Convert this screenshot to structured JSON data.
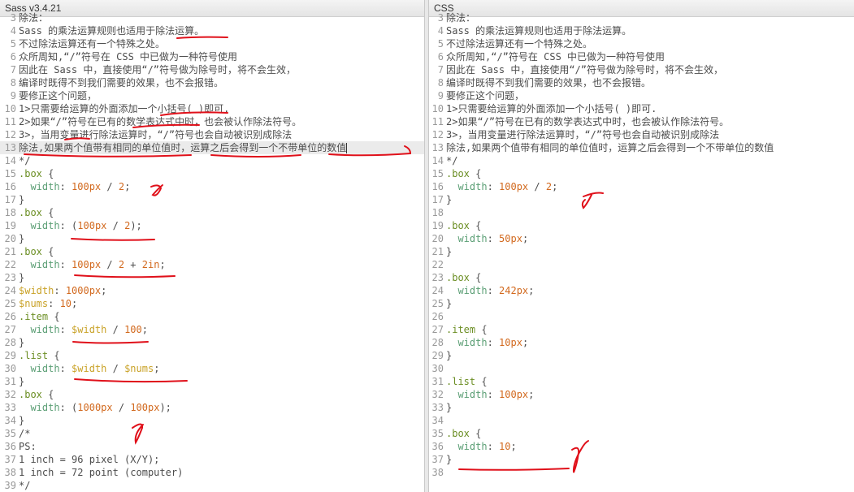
{
  "left_pane": {
    "title": "Sass v3.4.21",
    "lines": [
      {
        "n": "3",
        "t": "除法："
      },
      {
        "n": "4",
        "t": "Sass 的乘法运算规则也适用于除法运算。"
      },
      {
        "n": "5",
        "t": "不过除法运算还有一个特殊之处。"
      },
      {
        "n": "6",
        "t": "众所周知,“/”符号在 CSS 中已做为一种符号使用"
      },
      {
        "n": "7",
        "t": "因此在 Sass 中，直接使用“/”符号做为除号时，将不会生效，"
      },
      {
        "n": "8",
        "t": "编译时既得不到我们需要的效果，也不会报错。"
      },
      {
        "n": "9",
        "t": "要修正这个问题，"
      },
      {
        "n": "10",
        "t": "1>只需要给运算的外面添加一个小括号( )即可."
      },
      {
        "n": "11",
        "t": "2>如果“/”符号在已有的数学表达式中时，也会被认作除法符号。"
      },
      {
        "n": "12",
        "t": "3>，当用变量进行除法运算时，“/”符号也会自动被识别成除法"
      },
      {
        "n": "13",
        "t": "除法,如果两个值带有相同的单位值时，运算之后会得到一个不带单位的数值"
      },
      {
        "n": "14",
        "t": "*/"
      },
      {
        "n": "15",
        "t": ".box {"
      },
      {
        "n": "16",
        "t": "  width: 100px / 2;"
      },
      {
        "n": "17",
        "t": "}"
      },
      {
        "n": "18",
        "t": ".box {"
      },
      {
        "n": "19",
        "t": "  width: (100px / 2);"
      },
      {
        "n": "20",
        "t": "}"
      },
      {
        "n": "21",
        "t": ".box {"
      },
      {
        "n": "22",
        "t": "  width: 100px / 2 + 2in;"
      },
      {
        "n": "23",
        "t": "}"
      },
      {
        "n": "24",
        "t": "$width: 1000px;"
      },
      {
        "n": "25",
        "t": "$nums: 10;"
      },
      {
        "n": "26",
        "t": ".item {"
      },
      {
        "n": "27",
        "t": "  width: $width / 100;"
      },
      {
        "n": "28",
        "t": "}"
      },
      {
        "n": "29",
        "t": ".list {"
      },
      {
        "n": "30",
        "t": "  width: $width / $nums;"
      },
      {
        "n": "31",
        "t": "}"
      },
      {
        "n": "32",
        "t": ".box {"
      },
      {
        "n": "33",
        "t": "  width: (1000px / 100px);"
      },
      {
        "n": "34",
        "t": "}"
      },
      {
        "n": "35",
        "t": "/*"
      },
      {
        "n": "36",
        "t": "PS:"
      },
      {
        "n": "37",
        "t": "1 inch = 96 pixel (X/Y);"
      },
      {
        "n": "38",
        "t": "1 inch = 72 point (computer)"
      },
      {
        "n": "39",
        "t": "*/"
      }
    ]
  },
  "right_pane": {
    "title": "CSS",
    "lines": [
      {
        "n": "3",
        "t": "除法："
      },
      {
        "n": "4",
        "t": "Sass 的乘法运算规则也适用于除法运算。"
      },
      {
        "n": "5",
        "t": "不过除法运算还有一个特殊之处。"
      },
      {
        "n": "6",
        "t": "众所周知,“/”符号在 CSS 中已做为一种符号使用"
      },
      {
        "n": "7",
        "t": "因此在 Sass 中，直接使用“/”符号做为除号时，将不会生效，"
      },
      {
        "n": "8",
        "t": "编译时既得不到我们需要的效果，也不会报错。"
      },
      {
        "n": "9",
        "t": "要修正这个问题，"
      },
      {
        "n": "10",
        "t": "1>只需要给运算的外面添加一个小括号( )即可."
      },
      {
        "n": "11",
        "t": "2>如果“/”符号在已有的数学表达式中时，也会被认作除法符号。"
      },
      {
        "n": "12",
        "t": "3>，当用变量进行除法运算时，“/”符号也会自动被识别成除法"
      },
      {
        "n": "13",
        "t": "除法,如果两个值带有相同的单位值时，运算之后会得到一个不带单位的数值"
      },
      {
        "n": "14",
        "t": "*/"
      },
      {
        "n": "15",
        "t": ".box {"
      },
      {
        "n": "16",
        "t": "  width: 100px / 2;"
      },
      {
        "n": "17",
        "t": "}"
      },
      {
        "n": "18",
        "t": ""
      },
      {
        "n": "19",
        "t": ".box {"
      },
      {
        "n": "20",
        "t": "  width: 50px;"
      },
      {
        "n": "21",
        "t": "}"
      },
      {
        "n": "22",
        "t": ""
      },
      {
        "n": "23",
        "t": ".box {"
      },
      {
        "n": "24",
        "t": "  width: 242px;"
      },
      {
        "n": "25",
        "t": "}"
      },
      {
        "n": "26",
        "t": ""
      },
      {
        "n": "27",
        "t": ".item {"
      },
      {
        "n": "28",
        "t": "  width: 10px;"
      },
      {
        "n": "29",
        "t": "}"
      },
      {
        "n": "30",
        "t": ""
      },
      {
        "n": "31",
        "t": ".list {"
      },
      {
        "n": "32",
        "t": "  width: 100px;"
      },
      {
        "n": "33",
        "t": "}"
      },
      {
        "n": "34",
        "t": ""
      },
      {
        "n": "35",
        "t": ".box {"
      },
      {
        "n": "36",
        "t": "  width: 10;"
      },
      {
        "n": "37",
        "t": "}"
      },
      {
        "n": "38",
        "t": ""
      }
    ]
  },
  "colors": {
    "annotation": "#e0101a",
    "selector": "#6b8e23",
    "property": "#5a9e74",
    "value": "#d2691e",
    "variable": "#c9a227"
  }
}
